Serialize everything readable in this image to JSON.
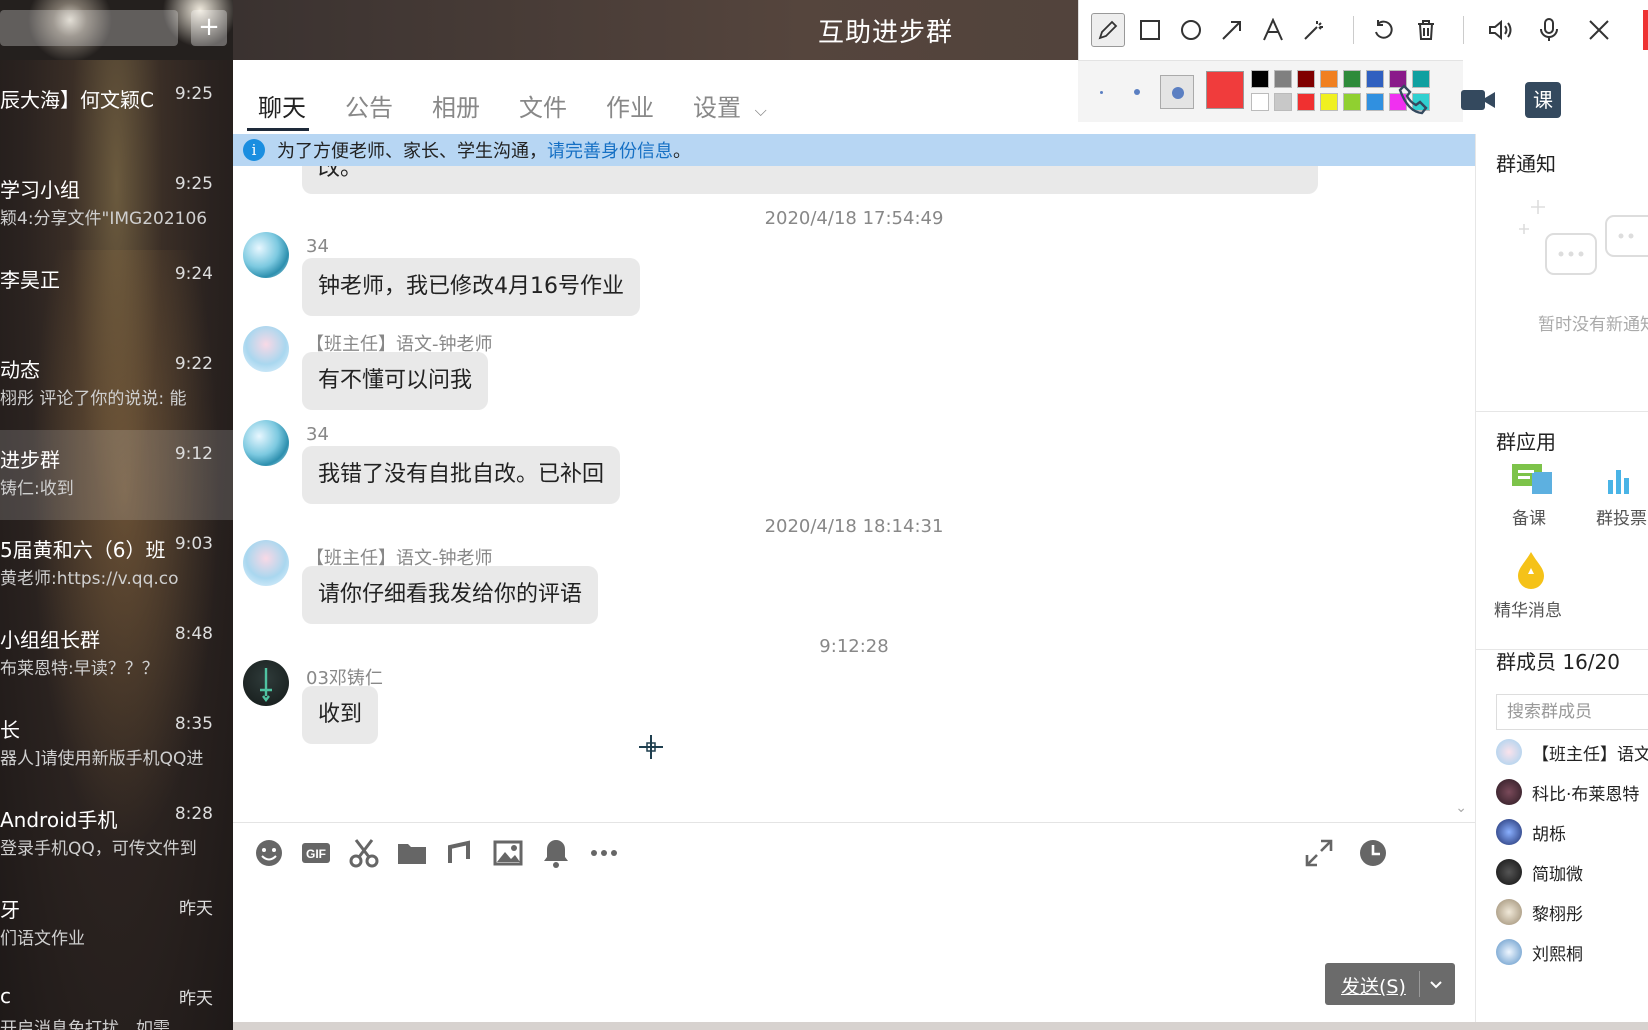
{
  "window": {
    "title": "互助进步群"
  },
  "sidebar": {
    "conversations": [
      {
        "name": "辰大海】何文颖C",
        "time": "9:25",
        "preview": ""
      },
      {
        "name": "学习小组",
        "time": "9:25",
        "preview": "颖4:分享文件\"IMG202106"
      },
      {
        "name": "李昊正",
        "time": "9:24",
        "preview": ""
      },
      {
        "name": "动态",
        "time": "9:22",
        "preview": "栩彤 评论了你的说说: 能"
      },
      {
        "name": "进步群",
        "time": "9:12",
        "preview": "铸仁:收到"
      },
      {
        "name": "5届黄和六（6）班",
        "time": "9:03",
        "preview": "黄老师:https://v.qq.co"
      },
      {
        "name": "小组组长群",
        "time": "8:48",
        "preview": "布莱恩特:早读？？？"
      },
      {
        "name": "长",
        "time": "8:35",
        "preview": "器人]请使用新版手机QQ进"
      },
      {
        "name": "Android手机",
        "time": "8:28",
        "preview": "登录手机QQ，可传文件到"
      },
      {
        "name": "牙",
        "time": "昨天",
        "preview": "们语文作业"
      },
      {
        "name": "c",
        "time": "昨天",
        "preview": "开启消息免打扰，如需"
      }
    ]
  },
  "annotation_toolbar": {
    "tools": [
      "pen-icon",
      "rectangle-icon",
      "circle-icon",
      "arrow-icon",
      "text-icon",
      "magic-wand-icon",
      "undo-icon",
      "trash-icon",
      "speaker-icon",
      "microphone-icon",
      "close-icon"
    ],
    "palette_colors_top": [
      "#000000",
      "#808080",
      "#800000",
      "#f08020",
      "#2e8b3a",
      "#3060c0",
      "#8a1a8a",
      "#10a0a0"
    ],
    "palette_colors_bottom": [
      "#ffffff",
      "#c8c8c8",
      "#f03030",
      "#f0f020",
      "#90d030",
      "#3090e0",
      "#f030f0",
      "#30d0d0"
    ],
    "current_color": "#f03c3c"
  },
  "tabs": [
    {
      "label": "聊天",
      "active": true
    },
    {
      "label": "公告"
    },
    {
      "label": "相册"
    },
    {
      "label": "文件"
    },
    {
      "label": "作业"
    },
    {
      "label": "设置"
    }
  ],
  "header_actions": {
    "class_label": "课"
  },
  "banner": {
    "text": "为了方便老师、家长、学生沟通，",
    "link": "请完善身份信息",
    "suffix": "。"
  },
  "chat": {
    "partial_message": "改。",
    "items": [
      {
        "kind": "stamp",
        "text": "2020/4/18 17:54:49"
      },
      {
        "kind": "msg",
        "sender": "34",
        "text": "钟老师，我已修改4月16号作业"
      },
      {
        "kind": "msg",
        "sender": "【班主任】语文-钟老师",
        "text": "有不懂可以问我"
      },
      {
        "kind": "msg",
        "sender": "34",
        "text": "我错了没有自批自改。已补回"
      },
      {
        "kind": "stamp",
        "text": "2020/4/18 18:14:31"
      },
      {
        "kind": "msg",
        "sender": "【班主任】语文-钟老师",
        "text": "请你仔细看我发给你的评语"
      },
      {
        "kind": "stamp",
        "text": "9:12:28"
      },
      {
        "kind": "msg",
        "sender": "03邓铸仁",
        "text": "收到"
      }
    ]
  },
  "input": {
    "send_label": "发送(S)"
  },
  "right_panel": {
    "notice_title": "群通知",
    "notice_empty": "暂时没有新通知",
    "apps_title": "群应用",
    "apps": [
      "备课",
      "群投票",
      "精华消息"
    ],
    "members_title": "群成员 16/20",
    "member_search_placeholder": "搜索群成员",
    "members": [
      "【班主任】语文-钟老师",
      "科比·布莱恩特",
      "胡栎",
      "简珈微",
      "黎栩彤",
      "刘熙桐"
    ]
  }
}
